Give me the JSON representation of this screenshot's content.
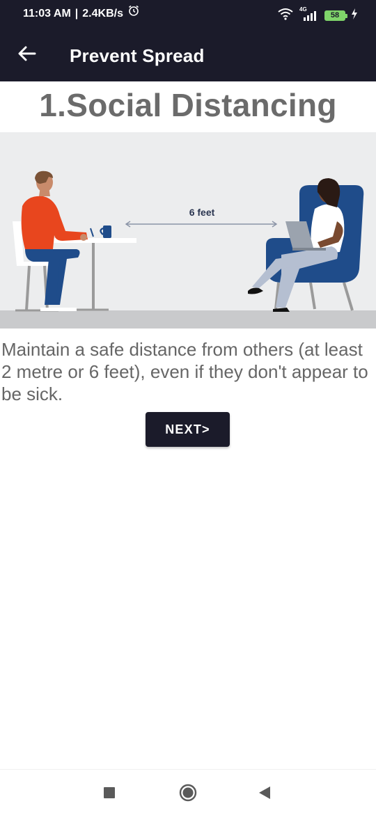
{
  "status_bar": {
    "time": "11:03 AM",
    "separator": "|",
    "speed": "2.4KB/s",
    "network": "4G",
    "battery": "58"
  },
  "app_bar": {
    "title": "Prevent Spread",
    "back_icon": "arrow-left-icon"
  },
  "content": {
    "heading": "1.Social Distancing",
    "illustration": {
      "distance_label": "6 feet"
    },
    "description": "Maintain a safe distance from others (at least 2 metre or 6 feet), even if they don't appear to be sick.",
    "next_label": "NEXT>"
  },
  "nav_bar": {
    "recents_icon": "square-icon",
    "home_icon": "circle-icon",
    "back_icon": "triangle-back-icon"
  },
  "colors": {
    "bar_background": "#1b1b2a",
    "heading_text": "#6b6b6b",
    "body_text": "#666666",
    "illustration_bg": "#ecedee",
    "floor": "#c9cacc",
    "shirt_orange": "#e8461e",
    "chair_blue": "#1f4c8a"
  }
}
